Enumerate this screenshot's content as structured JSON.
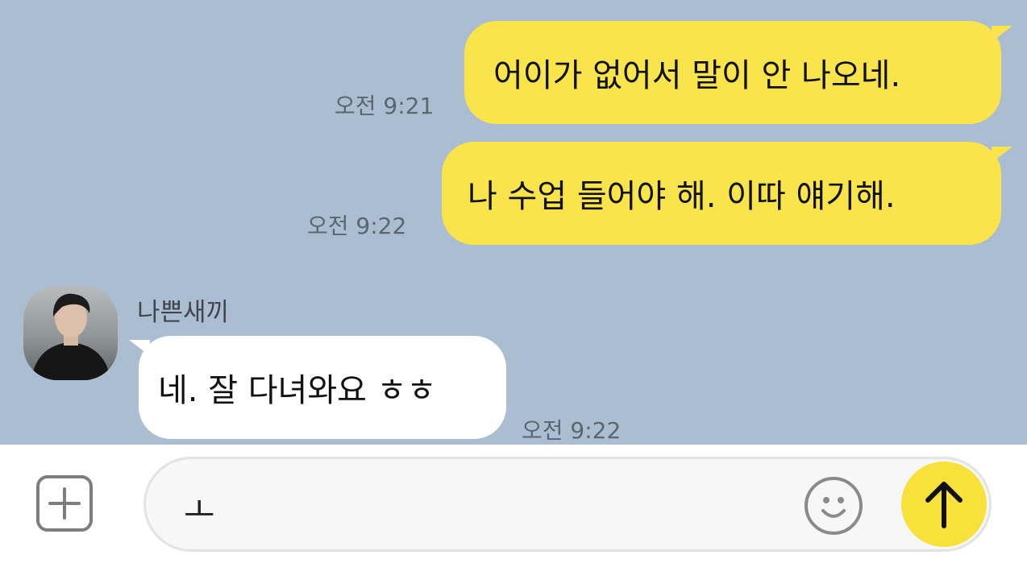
{
  "messages": [
    {
      "text": "어이가 없어서 말이 안 나오네.",
      "time": "오전 9:21",
      "from": "me"
    },
    {
      "text": "나 수업 들어야 해. 이따 얘기해.",
      "time": "오전 9:22",
      "from": "me"
    },
    {
      "text": "네. 잘 다녀와요 ㅎㅎ",
      "time": "오전 9:22",
      "from": "other",
      "sender": "나쁜새끼"
    }
  ],
  "composer": {
    "current_text": "ㅗ",
    "icons": {
      "attach": "plus-icon",
      "emoji": "smiley-icon",
      "send": "arrow-up-icon"
    }
  },
  "colors": {
    "background": "#abbdd0",
    "my_bubble": "#fae44c",
    "other_bubble": "#ffffff",
    "send_button": "#f7e13a"
  }
}
